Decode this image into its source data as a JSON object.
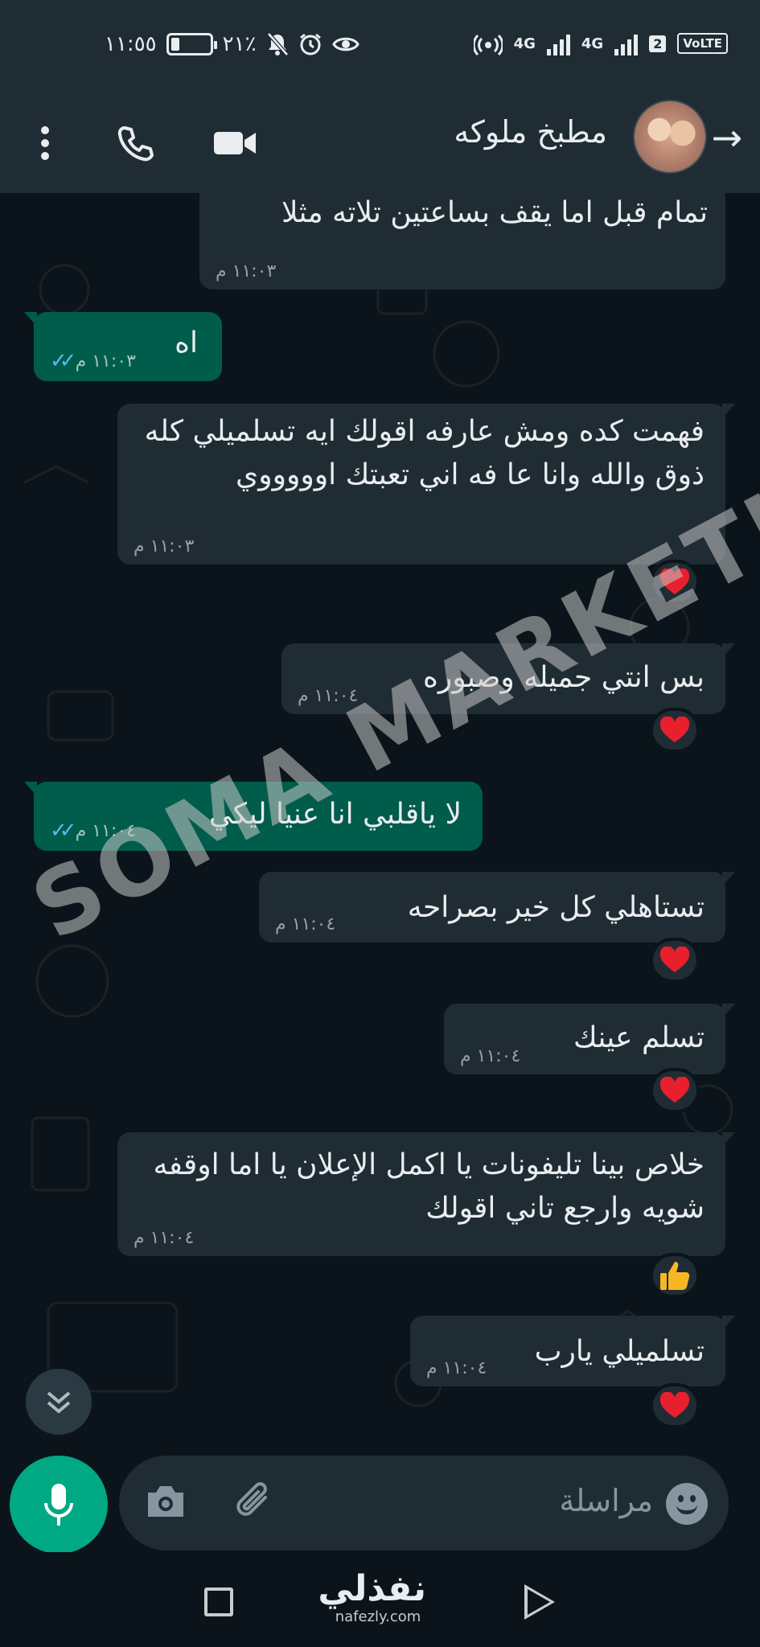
{
  "status_bar": {
    "time": "١١:٥٥",
    "battery_percent": "٢١٪",
    "battery_level": 0.21,
    "network_primary": "4G",
    "network_secondary": "4G",
    "sim_slot": "2",
    "volte": "VoLTE"
  },
  "header": {
    "contact_name": "مطبخ ملوكه",
    "icons": [
      "back-arrow-icon",
      "avatar",
      "video-call-icon",
      "voice-call-icon",
      "more-options-icon"
    ]
  },
  "messages": [
    {
      "direction": "in",
      "text": "تمام قبل اما يقف بساعتين تلاته مثلا",
      "time": "١١:٠٣ م"
    },
    {
      "direction": "out",
      "text": "اه",
      "time": "١١:٠٣ م",
      "status": "read"
    },
    {
      "direction": "in",
      "text": "فهمت كده ومش عارفه اقولك ايه تسلميلي كله ذوق والله وانا عا فه اني تعبتك اوووووي",
      "time": "١١:٠٣ م",
      "reaction": "heart"
    },
    {
      "direction": "in",
      "text": "بس انتي جميله وصبوره",
      "time": "١١:٠٤ م",
      "reaction": "heart"
    },
    {
      "direction": "out",
      "text": "لا ياقلبي انا عنيا ليكي",
      "time": "١١:٠٤ م",
      "status": "read"
    },
    {
      "direction": "in",
      "text": "تستاهلي كل خير بصراحه",
      "time": "١١:٠٤ م",
      "reaction": "heart"
    },
    {
      "direction": "in",
      "text": "تسلم عينك",
      "time": "١١:٠٤ م",
      "reaction": "heart"
    },
    {
      "direction": "in",
      "text": "خلاص بينا تليفونات يا اكمل الإعلان يا اما اوقفه شويه وارجع تاني اقولك",
      "time": "١١:٠٤ م",
      "reaction": "thumbs-up"
    },
    {
      "direction": "in",
      "text": "تسلميلي يارب",
      "time": "١١:٠٤ م",
      "reaction": "heart"
    }
  ],
  "watermark": "SOMA MARKETING",
  "composer": {
    "placeholder": "مراسلة",
    "icons": [
      "emoji-icon",
      "attach-icon",
      "camera-icon",
      "mic-icon"
    ]
  },
  "footer_brand": {
    "name": "نفذلي",
    "url": "nafezly.com"
  },
  "colors": {
    "background": "#0b141a",
    "incoming_bubble": "#202c33",
    "outgoing_bubble": "#005c4b",
    "accent": "#00a884",
    "read_ticks": "#53bdeb",
    "heart": "#e8202e"
  }
}
